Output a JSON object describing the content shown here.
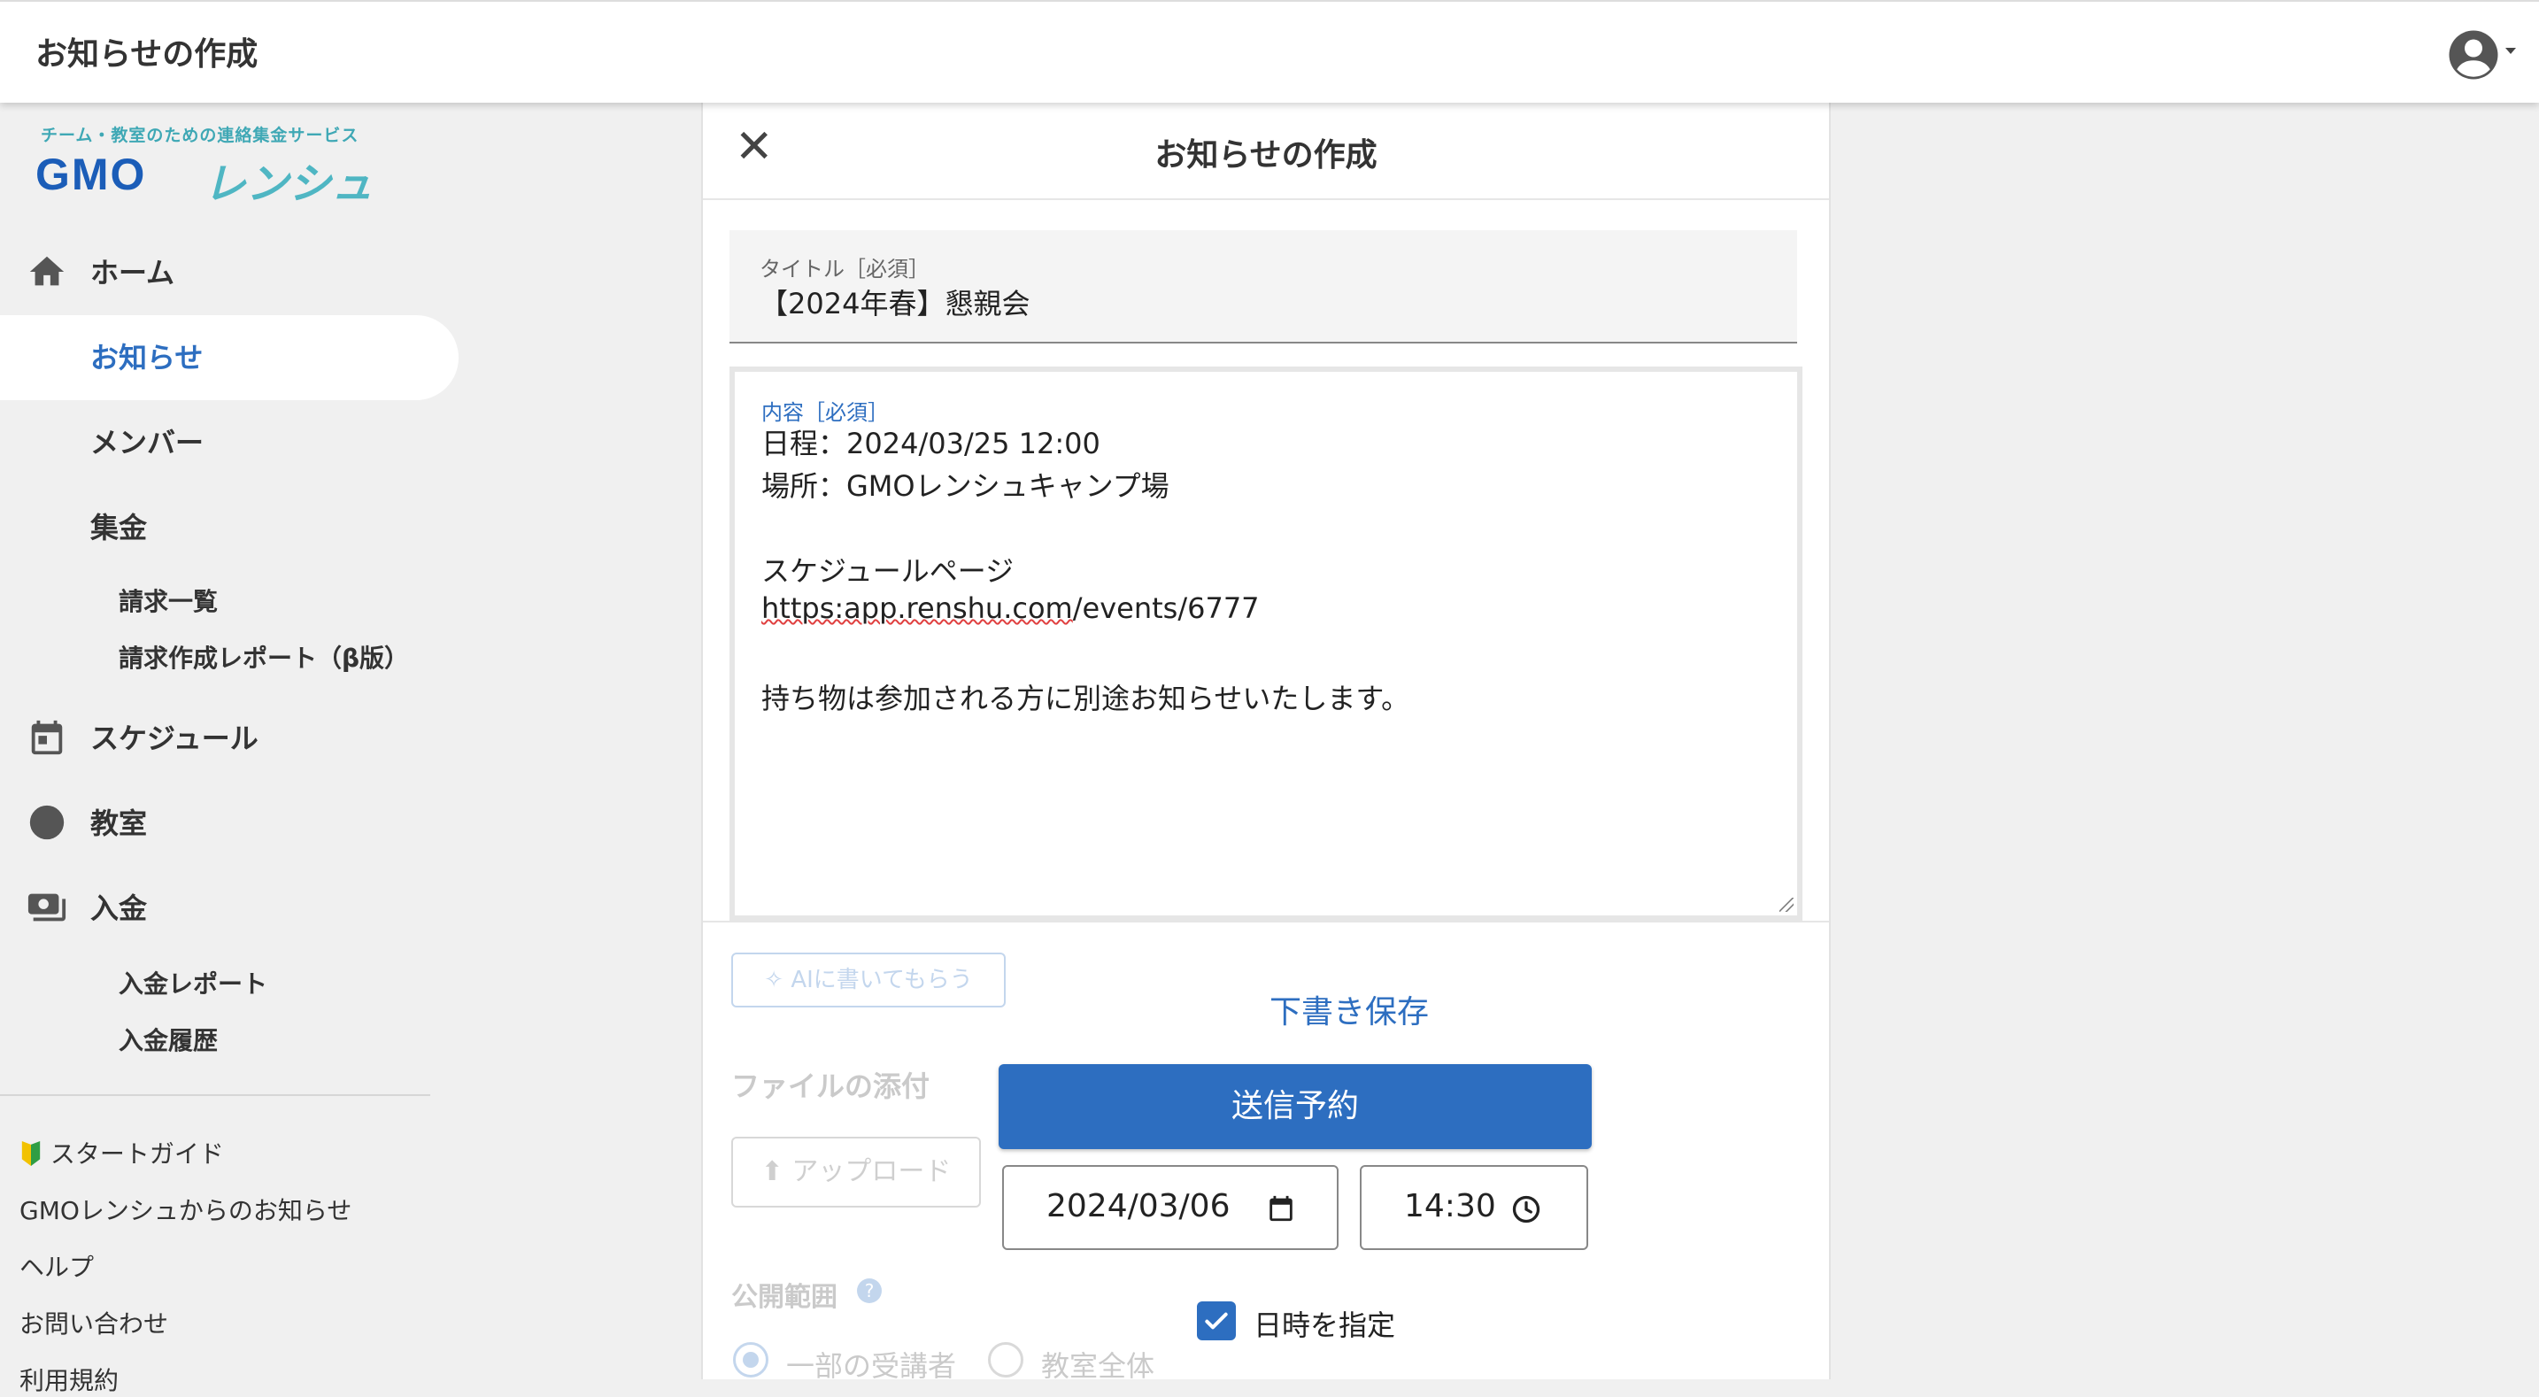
{
  "topbar": {
    "title": "お知らせの作成"
  },
  "brand": {
    "tagline": "チーム・教室のための連絡集金サービス",
    "gmo": "GMO",
    "ren": "レンシュ"
  },
  "nav": {
    "home": "ホーム",
    "notice": "お知らせ",
    "members": "メンバー",
    "billing": "集金",
    "billing_list": "請求一覧",
    "billing_report": "請求作成レポート（β版）",
    "schedule": "スケジュール",
    "classroom": "教室",
    "deposit": "入金",
    "deposit_report": "入金レポート",
    "deposit_history": "入金履歴"
  },
  "footer": {
    "start_guide": "スタートガイド",
    "gmo_notices": "GMOレンシュからのお知らせ",
    "help": "ヘルプ",
    "contact": "お問い合わせ",
    "terms": "利用規約"
  },
  "dialog": {
    "title": "お知らせの作成",
    "title_label": "タイトル［必須］",
    "title_value": "【2024年春】懇親会",
    "content_label": "内容［必須］",
    "content_lines": [
      "日程：2024/03/25 12:00",
      "場所：GMOレンシュキャンプ場",
      "スケジュールページ",
      "https:app.renshu.com",
      "/events/6777",
      "持ち物は参加される方に別途お知らせいたします。"
    ],
    "ai_button": "AIに書いてもらう",
    "attach_label": "ファイルの添付",
    "upload_button": "アップロード",
    "scope_label": "公開範囲",
    "scope_options": [
      "一部の受講者",
      "教室全体"
    ],
    "draft_save": "下書き保存",
    "send_schedule": "送信予約",
    "date_value": "2024/03/06",
    "time_value": "14:30",
    "specify_datetime": "日時を指定"
  },
  "colors": {
    "primary": "#2d6ec0",
    "accent_teal": "#4fb6c3",
    "background": "#f0f0f0"
  },
  "icons": [
    "account-circle-icon",
    "home-icon",
    "calendar-icon",
    "circle-icon",
    "payment-icon",
    "beginner-mark-icon",
    "close-icon",
    "sparkle-icon",
    "upload-icon",
    "help-icon",
    "clock-icon",
    "check-icon"
  ]
}
